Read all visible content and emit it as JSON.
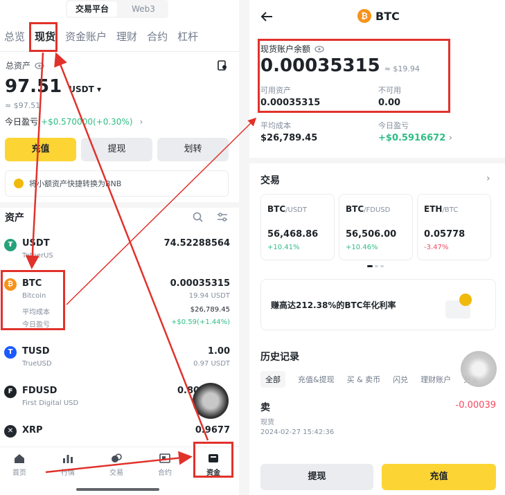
{
  "colors": {
    "accent": "#fcd535",
    "up": "#2ebd85",
    "down": "#f6465d",
    "annotation": "#e0322b"
  },
  "left": {
    "segment": [
      "交易平台",
      "Web3"
    ],
    "tabs": [
      "总览",
      "现货",
      "资金账户",
      "理财",
      "合约",
      "杠杆"
    ],
    "total_label": "总资产",
    "total_value": "97.51",
    "unit": "USDT",
    "total_usd": "≈ $97.51",
    "pnl_label": "今日盈亏",
    "pnl_value": "+$0.570000(+0.30%)",
    "buttons": [
      "充值",
      "提现",
      "划转"
    ],
    "convert_banner": "将小额资产快捷转换为BNB",
    "assets_title": "资产",
    "assets": [
      {
        "symbol": "USDT",
        "name": "TetherUS",
        "amount": "74.52288564",
        "sub": "",
        "icon_text": "₮",
        "color": "#26a17b"
      },
      {
        "symbol": "BTC",
        "name": "Bitcoin",
        "amount": "0.00035315",
        "sub": "19.94 USDT",
        "icon_text": "₿",
        "color": "#f7931a",
        "avg_label": "平均成本",
        "avg_value": "$26,789.45",
        "pnl_label": "今日盈亏",
        "pnl_value": "+$0.59(+1.44%)"
      },
      {
        "symbol": "TUSD",
        "name": "TrueUSD",
        "amount": "1.00",
        "sub": "0.97 USDT",
        "icon_text": "T",
        "color": "#1a5aff"
      },
      {
        "symbol": "FDUSD",
        "name": "First Digital USD",
        "amount": "0.80",
        "sub": "",
        "icon_text": "F",
        "color": "#1e2329"
      },
      {
        "symbol": "XRP",
        "name": "",
        "amount": "0.9677",
        "sub": "",
        "icon_text": "✕",
        "color": "#23292f"
      }
    ],
    "nav": [
      "首页",
      "行情",
      "交易",
      "合约",
      "资金"
    ]
  },
  "right": {
    "title": "BTC",
    "balance_label": "现货账户余额",
    "balance_value": "0.00035315",
    "balance_usd": "≈ $19.94",
    "available_label": "可用资产",
    "available_value": "0.00035315",
    "unavailable_label": "不可用",
    "unavailable_value": "0.00",
    "avg_cost_label": "平均成本",
    "avg_cost_value": "$26,789.45",
    "pnl_label": "今日盈亏",
    "pnl_value": "+$0.5916672",
    "trade_title": "交易",
    "pairs": [
      {
        "base": "BTC",
        "quote": "/USDT",
        "price": "56,468.86",
        "change": "+10.41%",
        "dir": "up"
      },
      {
        "base": "BTC",
        "quote": "/FDUSD",
        "price": "56,506.00",
        "change": "+10.46%",
        "dir": "up"
      },
      {
        "base": "ETH",
        "quote": "/BTC",
        "price": "0.05778",
        "change": "-3.47%",
        "dir": "down"
      }
    ],
    "earn_banner": "赚高达212.38%的BTC年化利率",
    "history_title": "历史记录",
    "history_tabs": [
      "全部",
      "充值&提现",
      "买 & 卖币",
      "闪兑",
      "理财账户",
      "分发"
    ],
    "record": {
      "type": "卖",
      "account": "现货",
      "time": "2024-02-27 15:42:36",
      "amount": "-0.00039"
    },
    "withdraw_label": "提现",
    "deposit_label": "充值"
  }
}
